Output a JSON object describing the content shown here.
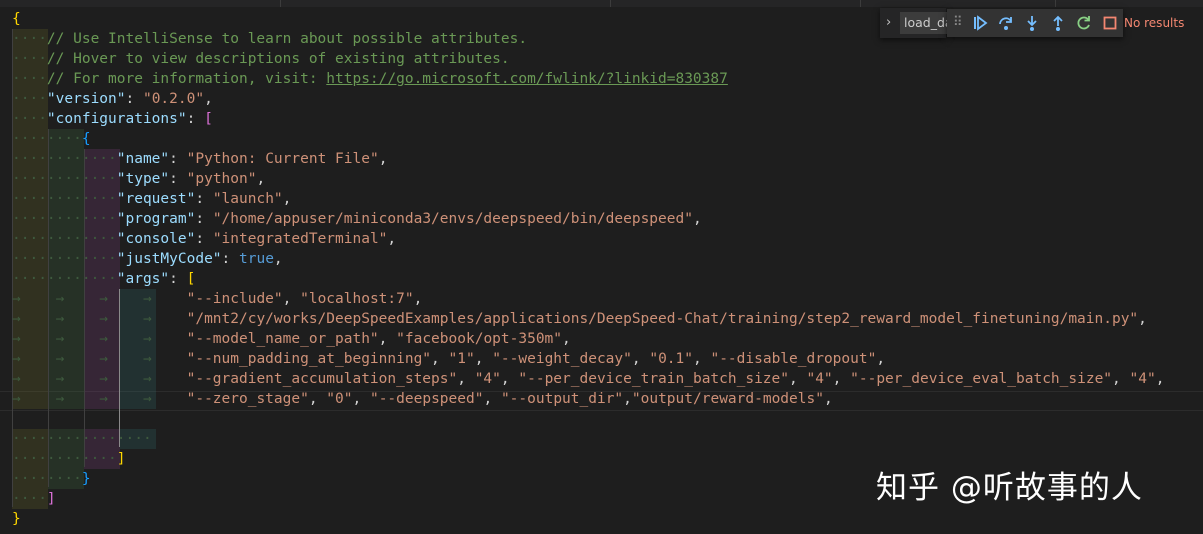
{
  "editor": {
    "lines": [
      "{",
      "// Use IntelliSense to learn about possible attributes.",
      "// Hover to view descriptions of existing attributes.",
      "// For more information, visit: ",
      "\"version\": \"0.2.0\",",
      "\"configurations\": [",
      "{",
      "\"name\": \"Python: Current File\",",
      "\"type\": \"python\",",
      "\"request\": \"launch\",",
      "\"program\": \"/home/appuser/miniconda3/envs/deepspeed/bin/deepspeed\",",
      "\"console\": \"integratedTerminal\",",
      "\"justMyCode\": true,",
      "\"args\": [",
      "\"--include\", \"localhost:7\",",
      "\"/mnt2/cy/works/DeepSpeedExamples/applications/DeepSpeed-Chat/training/step2_reward_model_finetuning/main.py\",",
      "\"--model_name_or_path\", \"facebook/opt-350m\",",
      "\"--num_padding_at_beginning\", \"1\", \"--weight_decay\", \"0.1\", \"--disable_dropout\",",
      "\"--gradient_accumulation_steps\", \"4\", \"--per_device_train_batch_size\", \"4\", \"--per_device_eval_batch_size\", \"4\",",
      "\"--zero_stage\", \"0\", \"--deepspeed\", \"--output_dir\",\"output/reward-models\",",
      "",
      "",
      "]",
      "}",
      "]",
      "}"
    ],
    "link_text": "https://go.microsoft.com/fwlink/?linkid=830387",
    "comment_color": "#6a9955",
    "key_color": "#9cdcfe",
    "string_color": "#ce9178",
    "keyword_color": "#569cd6"
  },
  "find_widget": {
    "query": "load_da",
    "results": "No results",
    "toggle_icon": "chevron-right-icon"
  },
  "debug_toolbar": {
    "buttons": [
      {
        "name": "drag-grip-icon"
      },
      {
        "name": "continue-icon"
      },
      {
        "name": "step-over-icon"
      },
      {
        "name": "step-into-icon"
      },
      {
        "name": "step-out-icon"
      },
      {
        "name": "restart-icon"
      },
      {
        "name": "stop-icon"
      }
    ]
  },
  "watermark": {
    "text": "知乎 @听故事的人"
  }
}
